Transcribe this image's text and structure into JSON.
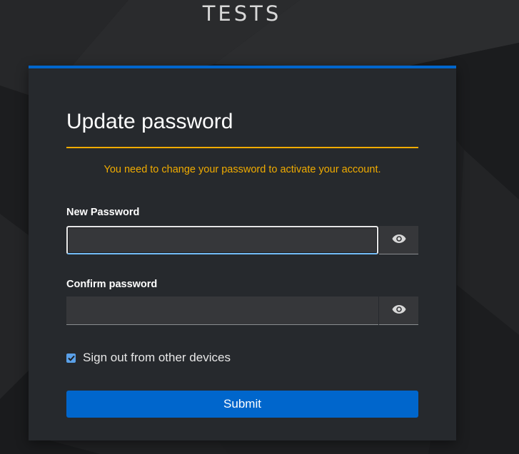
{
  "realm": {
    "name": "TESTS"
  },
  "form": {
    "title": "Update password",
    "alert": "You need to change your password to activate your account.",
    "new_password": {
      "label": "New Password",
      "value": "",
      "focused": true
    },
    "confirm_password": {
      "label": "Confirm password",
      "value": ""
    },
    "logout_sessions": {
      "label": "Sign out from other devices",
      "checked": true
    },
    "submit_label": "Submit"
  },
  "icons": {
    "show_password": "eye-icon",
    "checkbox": "check-icon"
  },
  "colors": {
    "accent": "#0066cc",
    "warning": "#f0ab00",
    "card_bg": "#26292d",
    "page_bg": "#1e1f21"
  }
}
